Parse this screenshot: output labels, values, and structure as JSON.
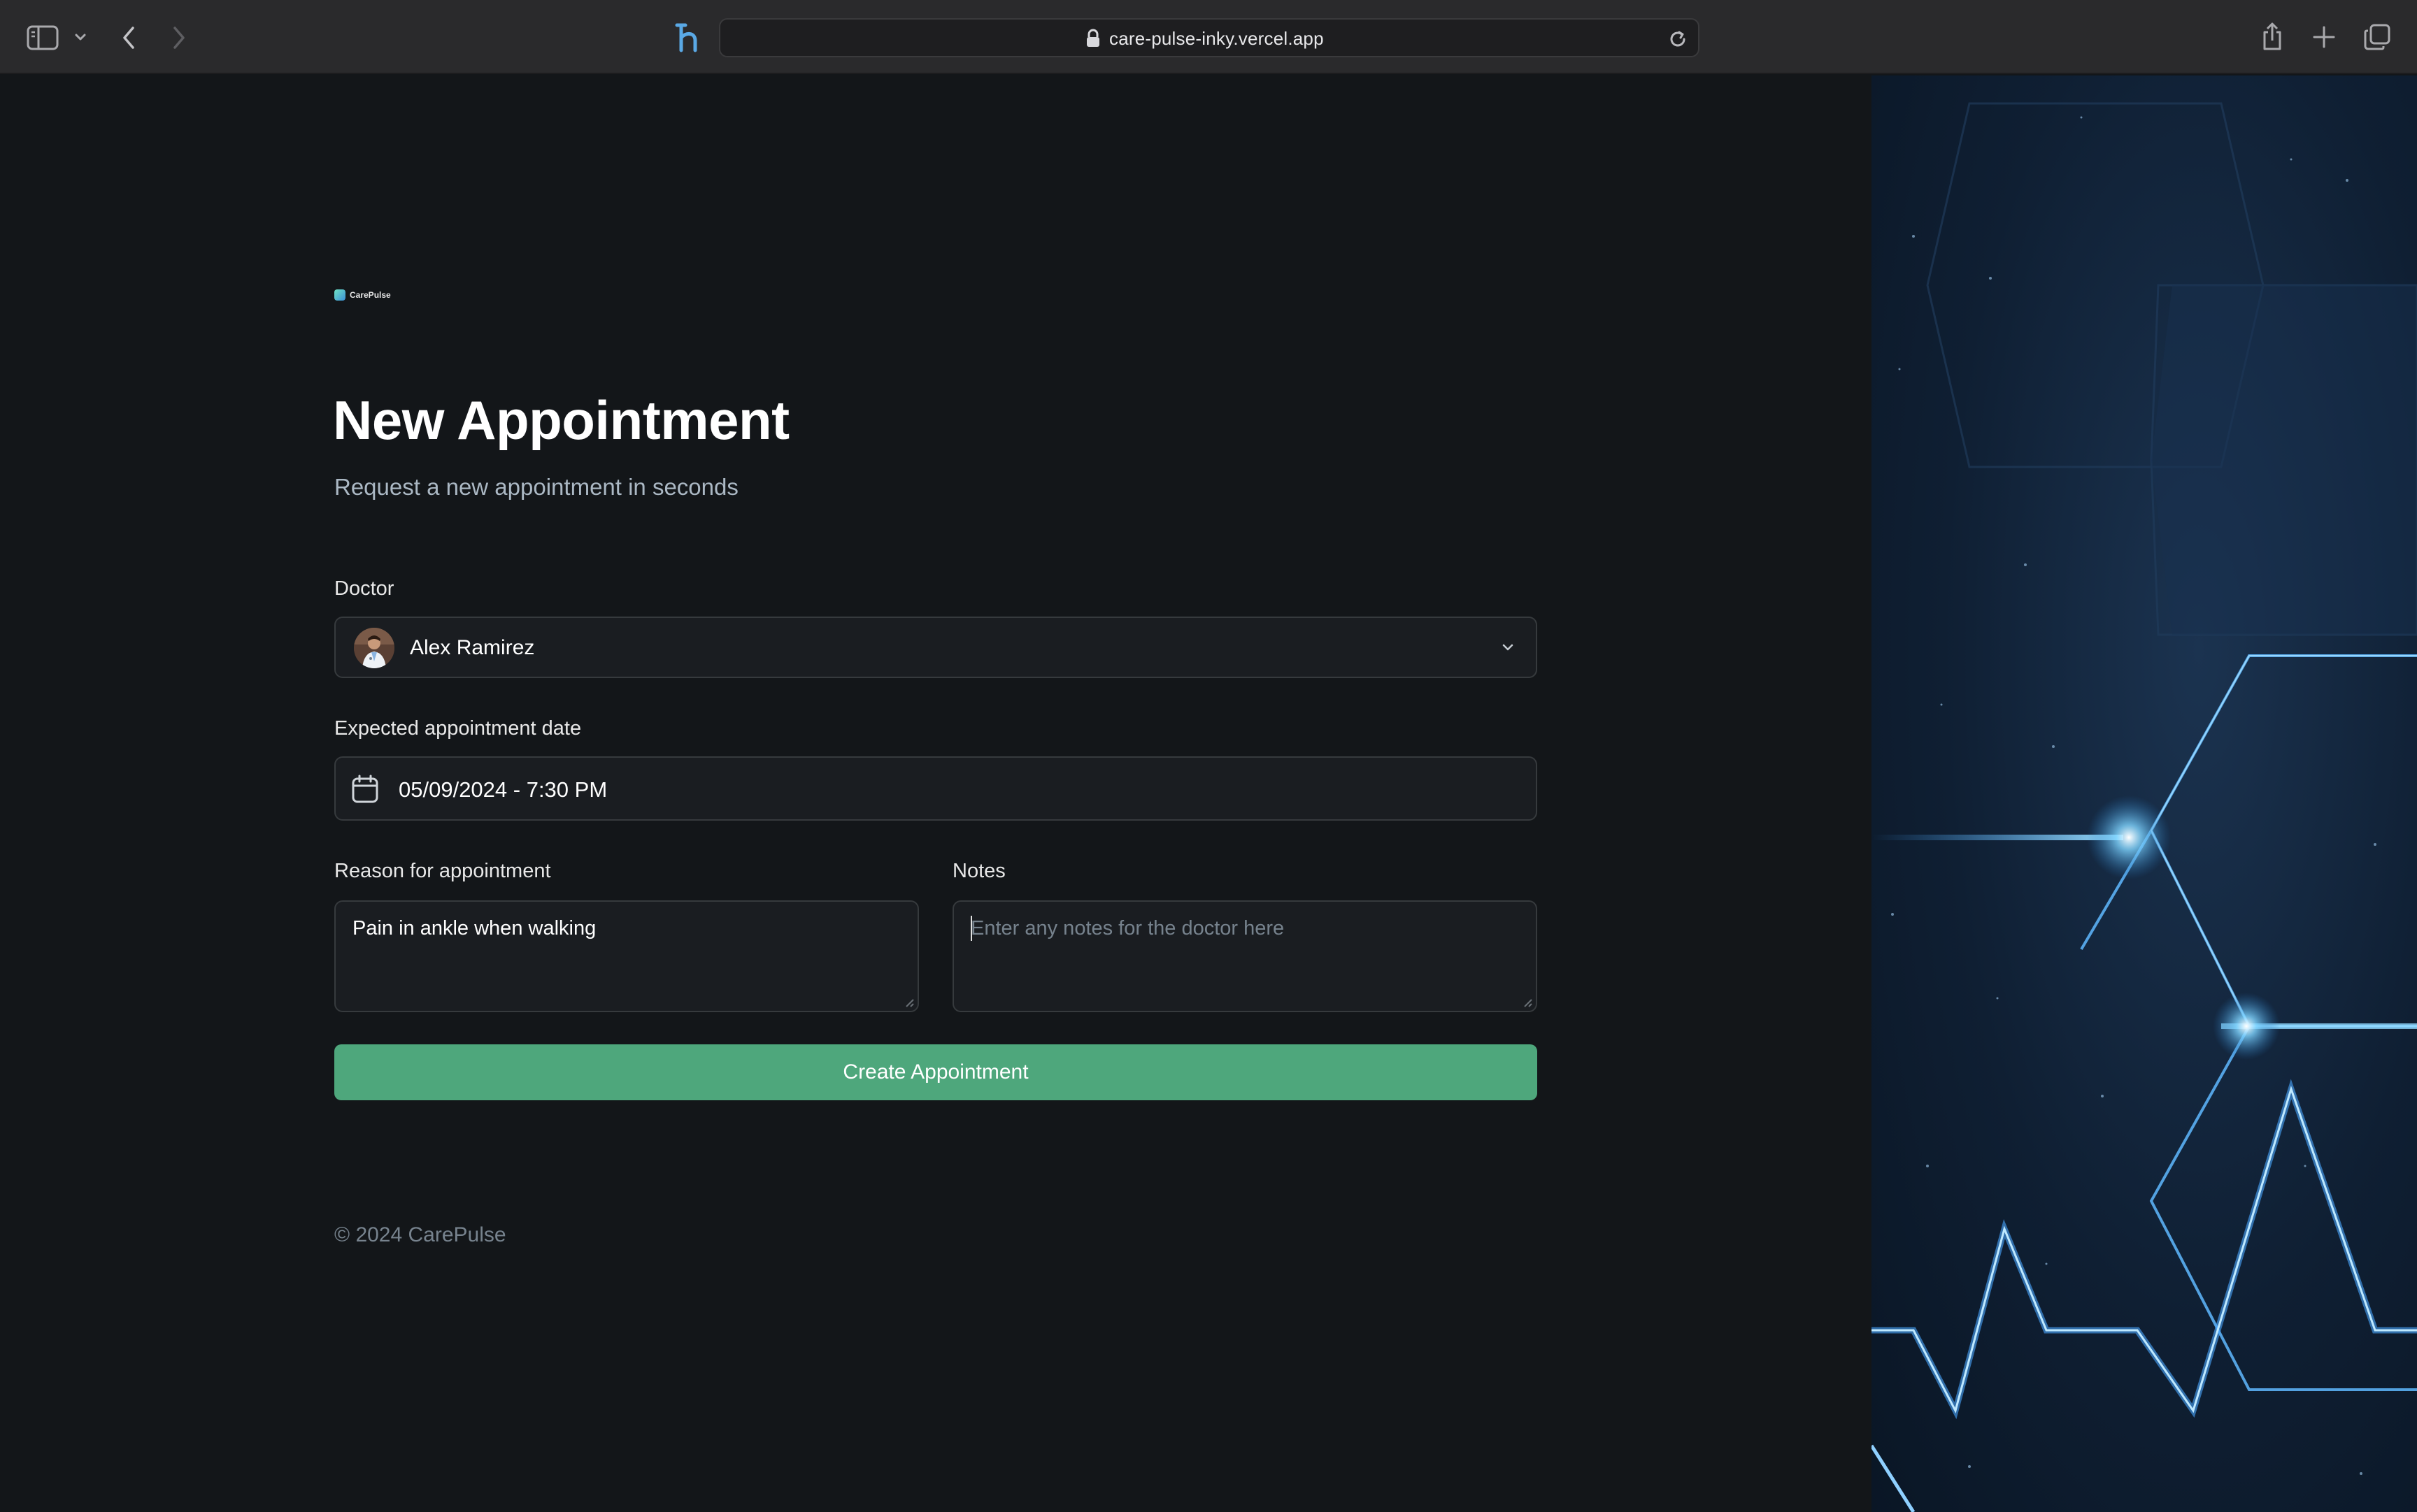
{
  "browser": {
    "url": "care-pulse-inky.vercel.app"
  },
  "brand": {
    "logo_text": "CarePulse",
    "accent_color": "#4ea77c",
    "background_color": "#131619"
  },
  "form": {
    "title": "New Appointment",
    "subtitle": "Request a new appointment in seconds",
    "doctor": {
      "label": "Doctor",
      "selected": "Alex Ramirez"
    },
    "date": {
      "label": "Expected appointment date",
      "value": "05/09/2024 - 7:30 PM"
    },
    "reason": {
      "label": "Reason for appointment",
      "value": "Pain in ankle when walking"
    },
    "notes": {
      "label": "Notes",
      "placeholder": "Enter any notes for the doctor here"
    },
    "submit_label": "Create Appointment"
  },
  "footer": {
    "copyright": "© 2024 CarePulse"
  }
}
